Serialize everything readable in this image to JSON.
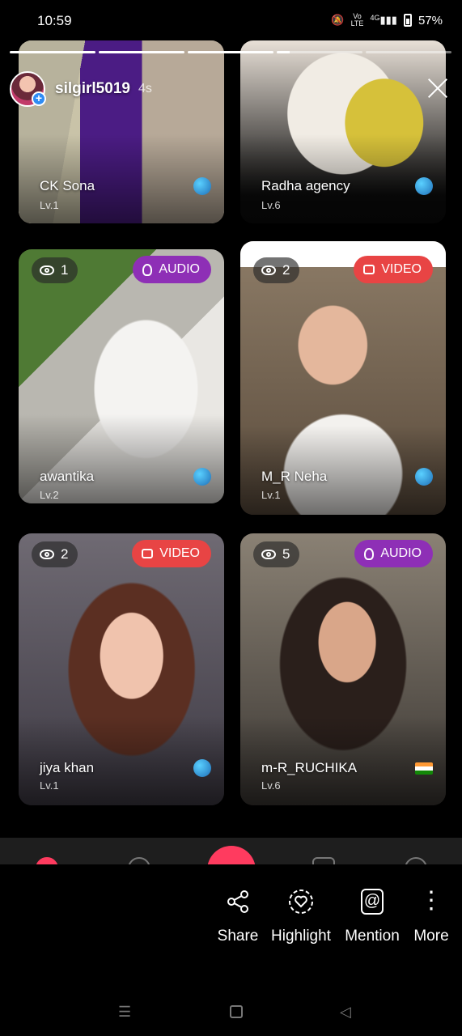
{
  "status_bar": {
    "time": "10:59",
    "icons": [
      "mute-icon",
      "volte-icon",
      "4g-signal-icon",
      "battery-icon"
    ],
    "volte": "Vo LTE",
    "network": "4G",
    "battery": "57%"
  },
  "story": {
    "segments": 5,
    "progress": [
      1,
      1,
      1,
      0.15,
      0
    ],
    "username": "silgirl5019",
    "time_ago": "4s"
  },
  "cards": [
    {
      "name": "CK Sona",
      "level": "Lv.1",
      "flag": "globe"
    },
    {
      "name": "Radha agency",
      "level": "Lv.6",
      "flag": "globe"
    },
    {
      "name": "awantika",
      "level": "Lv.2",
      "viewers": "1",
      "mode": "AUDIO",
      "flag": "globe"
    },
    {
      "name": "M_R Neha",
      "level": "Lv.1",
      "viewers": "2",
      "mode": "VIDEO",
      "flag": "globe"
    },
    {
      "name": "jiya khan",
      "level": "Lv.1",
      "viewers": "2",
      "mode": "VIDEO",
      "flag": "globe"
    },
    {
      "name": "m-R_RUCHIKA",
      "level": "Lv.6",
      "viewers": "5",
      "mode": "AUDIO",
      "flag": "india"
    }
  ],
  "actions": {
    "share": "Share",
    "highlight": "Highlight",
    "mention": "Mention",
    "more": "More",
    "mention_glyph": "@"
  },
  "colors": {
    "audio_badge": "#8e2fb6",
    "video_badge": "#e84444",
    "accent": "#ff3b5f"
  }
}
